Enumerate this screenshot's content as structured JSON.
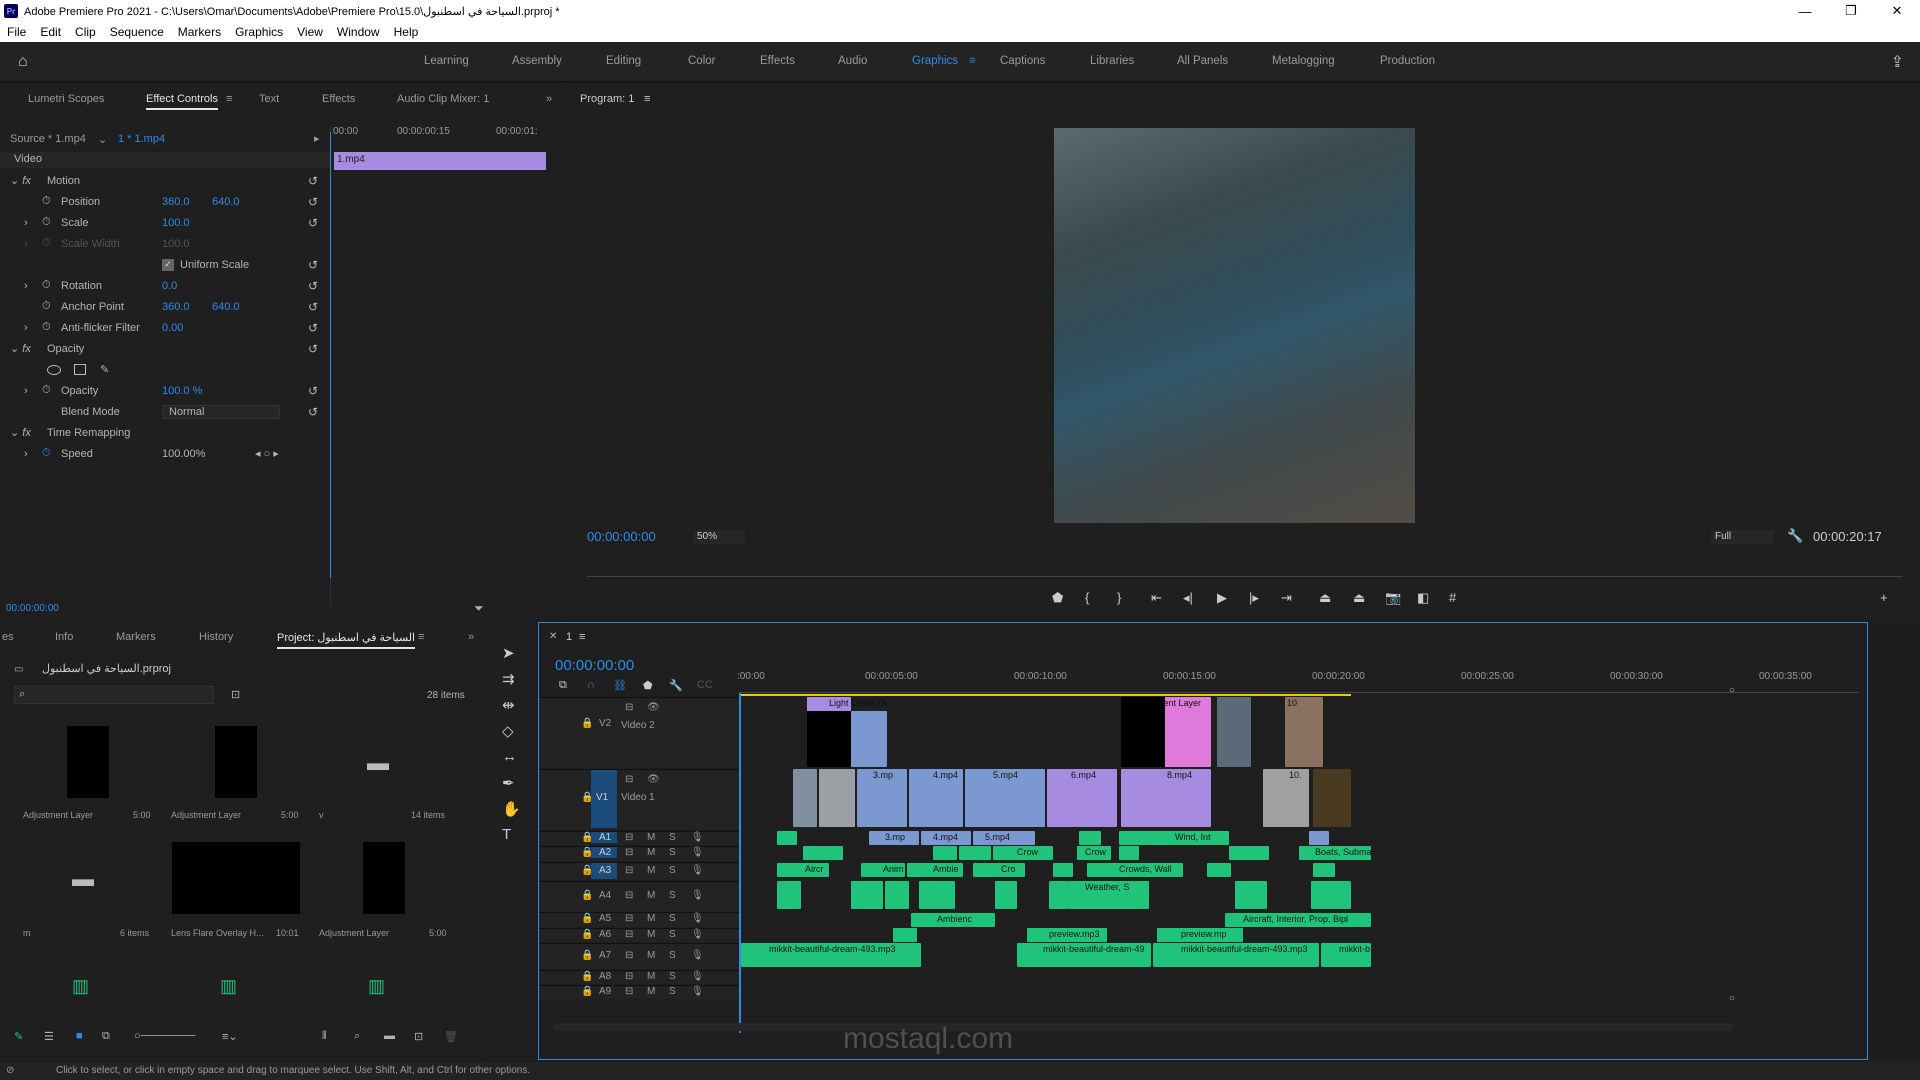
{
  "window": {
    "title": "Adobe Premiere Pro 2021 - C:\\Users\\Omar\\Documents\\Adobe\\Premiere Pro\\15.0\\السياحة في اسطنبول.prproj *",
    "icon": "Pr",
    "minimize": "—",
    "maximize": "❐",
    "close": "✕"
  },
  "menu": [
    "File",
    "Edit",
    "Clip",
    "Sequence",
    "Markers",
    "Graphics",
    "View",
    "Window",
    "Help"
  ],
  "workspaces": [
    "Learning",
    "Assembly",
    "Editing",
    "Color",
    "Effects",
    "Audio",
    "Graphics",
    "Captions",
    "Libraries",
    "All Panels",
    "Metalogging",
    "Production"
  ],
  "active_workspace": "Graphics",
  "effect_controls": {
    "tabs": [
      "Lumetri Scopes",
      "Effect Controls",
      "Text",
      "Effects",
      "Audio Clip Mixer: 1"
    ],
    "active_tab": "Effect Controls",
    "source": "Source * 1.mp4",
    "sequence": "1 * 1.mp4",
    "ruler": [
      "00:00",
      "00:00:00:15",
      "00:00:01:"
    ],
    "clip_label": "1.mp4",
    "video_label": "Video",
    "rows": [
      {
        "label": "Motion",
        "v1": "",
        "v2": ""
      },
      {
        "label": "Position",
        "v1": "360.0",
        "v2": "640.0"
      },
      {
        "label": "Scale",
        "v1": "100.0",
        "v2": ""
      },
      {
        "label": "Scale Width",
        "v1": "100.0",
        "v2": ""
      },
      {
        "label": "Uniform Scale",
        "v1": "",
        "v2": ""
      },
      {
        "label": "Rotation",
        "v1": "0.0",
        "v2": ""
      },
      {
        "label": "Anchor Point",
        "v1": "360.0",
        "v2": "640.0"
      },
      {
        "label": "Anti-flicker Filter",
        "v1": "0.00",
        "v2": ""
      },
      {
        "label": "Opacity",
        "v1": "",
        "v2": ""
      },
      {
        "label": "",
        "v1": "",
        "v2": ""
      },
      {
        "label": "Opacity",
        "v1": "100.0 %",
        "v2": ""
      },
      {
        "label": "Blend Mode",
        "v1": "Normal",
        "v2": ""
      },
      {
        "label": "Time Remapping",
        "v1": "",
        "v2": ""
      },
      {
        "label": "Speed",
        "v1": "100.00%",
        "v2": ""
      }
    ],
    "timecode": "00:00:00:00"
  },
  "program": {
    "title": "Program: 1",
    "timecode": "00:00:00:00",
    "zoom": "50%",
    "quality": "Full",
    "duration": "00:00:20:17"
  },
  "project": {
    "tabs": [
      "es",
      "Info",
      "Markers",
      "History",
      "Project: السياحة في اسطنبول"
    ],
    "active_tab": "Project: السياحة في اسطنبول",
    "filename": "السياحة في اسطنبول.prproj",
    "count": "28 items",
    "items": [
      {
        "name": "Adjustment Layer",
        "meta": "5:00"
      },
      {
        "name": "Adjustment Layer",
        "meta": "5:00"
      },
      {
        "name": "v",
        "meta": "14 items"
      },
      {
        "name": "m",
        "meta": "6 items"
      },
      {
        "name": "Lens Flare  Overlay H...",
        "meta": "10:01"
      },
      {
        "name": "Adjustment Layer",
        "meta": "5:00"
      }
    ]
  },
  "timeline": {
    "tab": "1",
    "timecode": "00:00:00:00",
    "ruler": [
      ":00:00",
      "00:00:05:00",
      "00:00:10:00",
      "00:00:15:00",
      "00:00:20:00",
      "00:00:25:00",
      "00:00:30:00",
      "00:00:35:00"
    ],
    "v2_label": "Video 2",
    "v1_label": "Video 1",
    "track_names": [
      "V2",
      "V1",
      "A1",
      "A2",
      "A3",
      "A4",
      "A5",
      "A6",
      "A7",
      "A8",
      "A9"
    ],
    "clips": {
      "v2": [
        "Light Leaks Ov",
        "Adjustment Layer",
        "10"
      ],
      "v1": [
        "3.mp",
        "4.mp4",
        "5.mp4",
        "6.mp4",
        "8.mp4",
        "10."
      ],
      "a1": [
        "3.mp",
        "4.mp4",
        "5.mp4",
        "Wind, Int"
      ],
      "a2": [
        "Crow",
        "Crow",
        "Boats, Submar"
      ],
      "a3": [
        "Aircr",
        "Anim",
        "Ambie",
        "Cro",
        "Crowds, Wall"
      ],
      "a4": [
        "Weather, S"
      ],
      "a5": [
        "Ambienc",
        "Aircraft, Interior, Prop, Bipl"
      ],
      "a6": [
        "preview.mp3",
        "preview.mp"
      ],
      "a7": [
        "mikkit-beautiful-dream-493.mp3",
        "mikkit-beautiful-dream-49",
        "mikkit-beautiful-dream-493.mp3",
        "mikkit-b"
      ]
    }
  },
  "status": "Click to select, or click in empty space and drag to marquee select. Use Shift, Alt, and Ctrl for other options.",
  "watermark": "mostaql.com"
}
